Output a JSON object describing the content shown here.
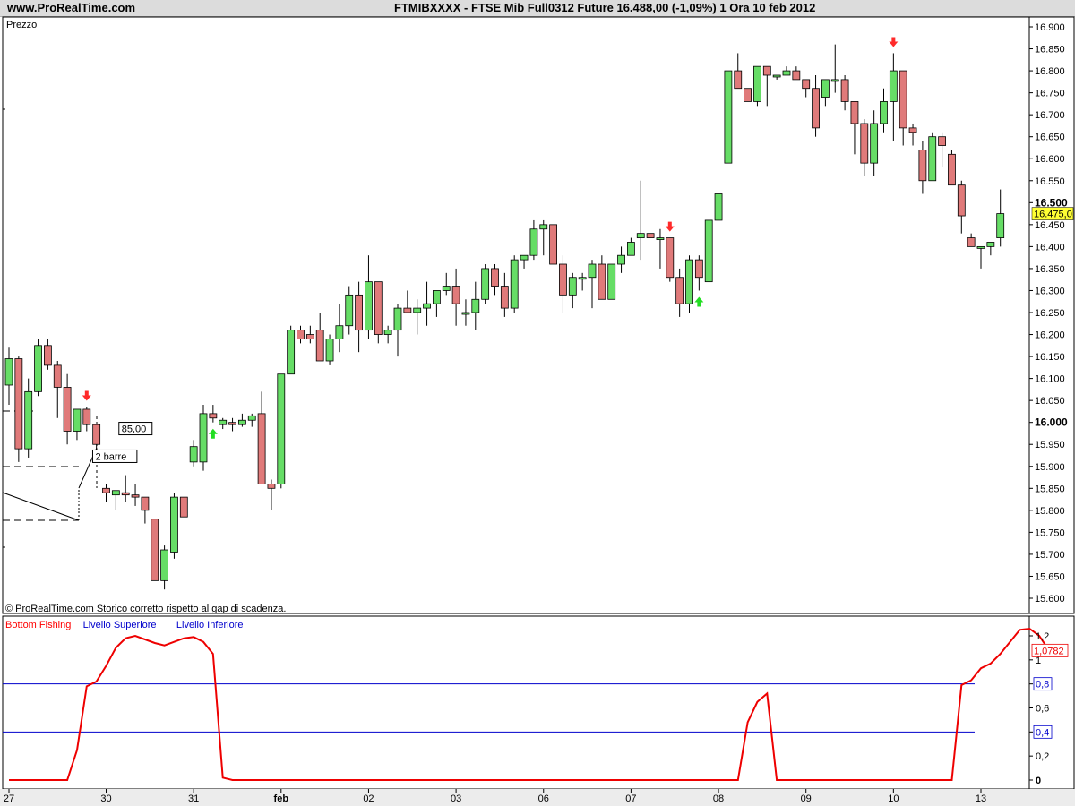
{
  "header": {
    "site": "www.ProRealTime.com",
    "title": "FTMIBXXXX - FTSE Mib Full0312 Future    16.488,00 (-1,09%)    1 Ora  10 feb 2012"
  },
  "chart_data": [
    {
      "type": "candlestick",
      "panel_label": "Prezzo",
      "footnote": "© ProRealTime.com  Storico corretto rispetto al gap di scadenza.",
      "yaxis": {
        "range": [
          15580,
          16930
        ],
        "ticks": [
          "16.900",
          "16.850",
          "16.800",
          "16.750",
          "16.700",
          "16.650",
          "16.600",
          "16.550",
          "16.500",
          "16.450",
          "16.400",
          "16.350",
          "16.300",
          "16.250",
          "16.200",
          "16.150",
          "16.100",
          "16.050",
          "16.000",
          "15.950",
          "15.900",
          "15.850",
          "15.800",
          "15.750",
          "15.700",
          "15.650",
          "15.600"
        ],
        "bold_ticks": [
          "16.500",
          "16.000"
        ],
        "last_price_label": "16.475,0",
        "last_price": 16475
      },
      "xaxis": {
        "labels": [
          {
            "text": "27",
            "bar": 0
          },
          {
            "text": "30",
            "bar": 10
          },
          {
            "text": "31",
            "bar": 19
          },
          {
            "text": "feb",
            "bar": 28,
            "bold": true
          },
          {
            "text": "02",
            "bar": 37
          },
          {
            "text": "03",
            "bar": 46
          },
          {
            "text": "06",
            "bar": 55
          },
          {
            "text": "07",
            "bar": 64
          },
          {
            "text": "08",
            "bar": 73
          },
          {
            "text": "09",
            "bar": 82
          },
          {
            "text": "10",
            "bar": 91
          },
          {
            "text": "13",
            "bar": 100
          }
        ]
      },
      "candles": [
        [
          16085,
          16170,
          16040,
          16145
        ],
        [
          16145,
          16150,
          15910,
          15940
        ],
        [
          15940,
          16100,
          15920,
          16070
        ],
        [
          16070,
          16190,
          16060,
          16175
        ],
        [
          16175,
          16190,
          16120,
          16130
        ],
        [
          16130,
          16140,
          16010,
          16080
        ],
        [
          16080,
          16110,
          15950,
          15980
        ],
        [
          15980,
          16030,
          15960,
          16030
        ],
        [
          16030,
          16035,
          15980,
          15995
        ],
        [
          15995,
          15995,
          15940,
          15950
        ],
        [
          15850,
          15860,
          15820,
          15840
        ],
        [
          15835,
          15840,
          15800,
          15845
        ],
        [
          15840,
          15880,
          15820,
          15835
        ],
        [
          15835,
          15860,
          15810,
          15830
        ],
        [
          15830,
          15830,
          15770,
          15800
        ],
        [
          15780,
          15780,
          15640,
          15640
        ],
        [
          15640,
          15720,
          15620,
          15710
        ],
        [
          15705,
          15840,
          15690,
          15830
        ],
        [
          15830,
          15830,
          15800,
          15785
        ],
        [
          15910,
          15960,
          15900,
          15945
        ],
        [
          15910,
          16040,
          15890,
          16020
        ],
        [
          16020,
          16040,
          16000,
          16010
        ],
        [
          15995,
          16010,
          15985,
          16005
        ],
        [
          16000,
          16010,
          15980,
          15995
        ],
        [
          15995,
          16020,
          15990,
          16005
        ],
        [
          16005,
          16020,
          15990,
          16015
        ],
        [
          16020,
          16070,
          15960,
          15860
        ],
        [
          15860,
          15870,
          15800,
          15850
        ],
        [
          15860,
          16110,
          15850,
          16110
        ],
        [
          16110,
          16220,
          16110,
          16210
        ],
        [
          16210,
          16220,
          16180,
          16190
        ],
        [
          16200,
          16220,
          16180,
          16190
        ],
        [
          16210,
          16250,
          16180,
          16140
        ],
        [
          16140,
          16200,
          16130,
          16190
        ],
        [
          16190,
          16270,
          16160,
          16220
        ],
        [
          16220,
          16310,
          16200,
          16290
        ],
        [
          16290,
          16320,
          16160,
          16210
        ],
        [
          16210,
          16380,
          16190,
          16320
        ],
        [
          16320,
          16320,
          16180,
          16200
        ],
        [
          16200,
          16220,
          16180,
          16210
        ],
        [
          16210,
          16270,
          16150,
          16260
        ],
        [
          16260,
          16300,
          16250,
          16250
        ],
        [
          16250,
          16280,
          16200,
          16260
        ],
        [
          16260,
          16320,
          16220,
          16270
        ],
        [
          16270,
          16300,
          16240,
          16300
        ],
        [
          16300,
          16340,
          16290,
          16310
        ],
        [
          16310,
          16350,
          16220,
          16270
        ],
        [
          16250,
          16280,
          16220,
          16250
        ],
        [
          16250,
          16320,
          16210,
          16280
        ],
        [
          16280,
          16360,
          16270,
          16350
        ],
        [
          16350,
          16360,
          16290,
          16310
        ],
        [
          16310,
          16340,
          16240,
          16260
        ],
        [
          16260,
          16380,
          16250,
          16370
        ],
        [
          16370,
          16380,
          16350,
          16380
        ],
        [
          16380,
          16460,
          16370,
          16440
        ],
        [
          16440,
          16460,
          16380,
          16450
        ],
        [
          16450,
          16450,
          16360,
          16360
        ],
        [
          16360,
          16380,
          16250,
          16290
        ],
        [
          16290,
          16340,
          16260,
          16330
        ],
        [
          16330,
          16340,
          16300,
          16330
        ],
        [
          16330,
          16370,
          16260,
          16360
        ],
        [
          16360,
          16380,
          16290,
          16280
        ],
        [
          16280,
          16360,
          16280,
          16360
        ],
        [
          16360,
          16400,
          16340,
          16380
        ],
        [
          16380,
          16420,
          16380,
          16410
        ],
        [
          16420,
          16550,
          16370,
          16430
        ],
        [
          16430,
          16430,
          16420,
          16420
        ],
        [
          16420,
          16440,
          16350,
          16420
        ],
        [
          16420,
          16420,
          16320,
          16330
        ],
        [
          16330,
          16350,
          16240,
          16270
        ],
        [
          16270,
          16380,
          16250,
          16370
        ],
        [
          16370,
          16380,
          16300,
          16330
        ],
        [
          16320,
          16460,
          16320,
          16460
        ],
        [
          16460,
          16520,
          16460,
          16520
        ],
        [
          16590,
          16800,
          16590,
          16800
        ],
        [
          16800,
          16840,
          16780,
          16760
        ],
        [
          16760,
          16740,
          16730,
          16730
        ],
        [
          16730,
          16810,
          16720,
          16810
        ],
        [
          16810,
          16790,
          16720,
          16790
        ],
        [
          16790,
          16790,
          16780,
          16790
        ],
        [
          16790,
          16810,
          16790,
          16800
        ],
        [
          16800,
          16810,
          16790,
          16780
        ],
        [
          16780,
          16780,
          16740,
          16760
        ],
        [
          16760,
          16790,
          16650,
          16670
        ],
        [
          16740,
          16780,
          16720,
          16780
        ],
        [
          16780,
          16860,
          16750,
          16780
        ],
        [
          16780,
          16790,
          16710,
          16730
        ],
        [
          16730,
          16730,
          16610,
          16680
        ],
        [
          16680,
          16690,
          16560,
          16590
        ],
        [
          16590,
          16710,
          16560,
          16680
        ],
        [
          16680,
          16760,
          16660,
          16730
        ],
        [
          16730,
          16840,
          16640,
          16800
        ],
        [
          16800,
          16790,
          16630,
          16670
        ],
        [
          16670,
          16680,
          16630,
          16660
        ],
        [
          16620,
          16640,
          16520,
          16550
        ],
        [
          16550,
          16660,
          16550,
          16650
        ],
        [
          16650,
          16660,
          16580,
          16630
        ],
        [
          16610,
          16620,
          16540,
          16540
        ],
        [
          16540,
          16550,
          16430,
          16470
        ],
        [
          16420,
          16430,
          16400,
          16400
        ],
        [
          16400,
          16400,
          16350,
          16400
        ],
        [
          16400,
          16400,
          16380,
          16410
        ],
        [
          16420,
          16530,
          16400,
          16475
        ]
      ],
      "arrows": [
        {
          "bar": 8,
          "dir": "down",
          "color": "#ff2a2a"
        },
        {
          "bar": 21,
          "dir": "up",
          "color": "#22dd22"
        },
        {
          "bar": 68,
          "dir": "down",
          "color": "#ff2a2a"
        },
        {
          "bar": 71,
          "dir": "up",
          "color": "#22dd22"
        },
        {
          "bar": 91,
          "dir": "down",
          "color": "#ff2a2a"
        }
      ],
      "annotations": [
        {
          "text": "85,00",
          "bar": 11.5,
          "value": 15984
        },
        {
          "text": "2 barre",
          "bar": 8.8,
          "value": 15921
        }
      ],
      "colors": {
        "up": "#66dd66",
        "down": "#e07a7a",
        "wick": "#000000",
        "highlight": "#ffff33"
      }
    },
    {
      "type": "line",
      "legend": [
        {
          "name": "Bottom Fishing",
          "color": "#ff0000"
        },
        {
          "name": "Livello Superiore",
          "color": "#0000cc"
        },
        {
          "name": "Livello Inferiore",
          "color": "#0000cc"
        }
      ],
      "yaxis": {
        "range": [
          -0.05,
          1.4
        ],
        "ticks": [
          "1,2",
          "1",
          "0,8",
          "0,6",
          "0,4",
          "0,2",
          "0"
        ],
        "boxed_ticks": [
          "0,8",
          "0,4"
        ],
        "last_value_label": "1,0782"
      },
      "levels": [
        0.8,
        0.4
      ],
      "values": [
        0,
        0,
        0,
        0,
        0,
        0,
        0,
        0.25,
        0.78,
        0.82,
        0.95,
        1.1,
        1.18,
        1.2,
        1.17,
        1.14,
        1.12,
        1.15,
        1.18,
        1.19,
        1.15,
        1.05,
        0.02,
        0,
        0,
        0,
        0,
        0,
        0,
        0,
        0,
        0,
        0,
        0,
        0,
        0,
        0,
        0,
        0,
        0,
        0,
        0,
        0,
        0,
        0,
        0,
        0,
        0,
        0,
        0,
        0,
        0,
        0,
        0,
        0,
        0,
        0,
        0,
        0,
        0,
        0,
        0,
        0,
        0,
        0,
        0,
        0,
        0,
        0,
        0,
        0,
        0,
        0,
        0,
        0,
        0,
        0.48,
        0.65,
        0.72,
        0,
        0,
        0,
        0,
        0,
        0,
        0,
        0,
        0,
        0,
        0,
        0,
        0,
        0,
        0,
        0,
        0,
        0,
        0,
        0.79,
        0.83,
        0.93,
        0.97,
        1.05,
        1.15,
        1.25,
        1.26,
        1.2,
        1.0782
      ]
    }
  ]
}
